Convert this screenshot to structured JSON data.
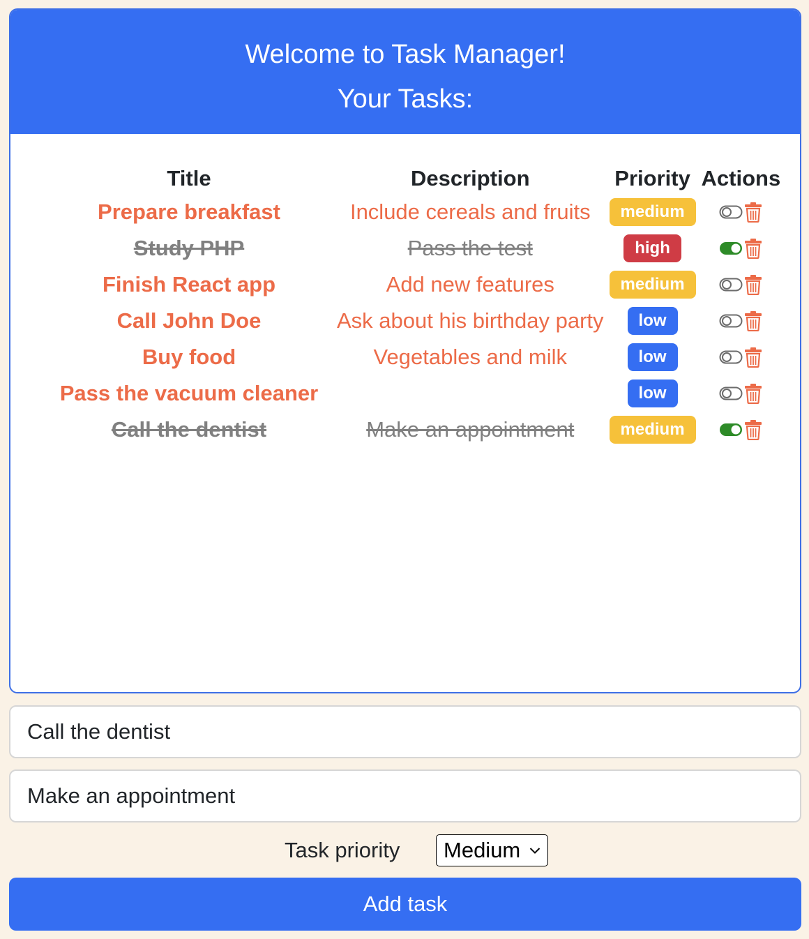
{
  "header": {
    "welcome": "Welcome to Task Manager!",
    "subtitle": "Your Tasks:"
  },
  "table": {
    "columns": [
      "Title",
      "Description",
      "Priority",
      "Actions"
    ]
  },
  "tasks": [
    {
      "title": "Prepare breakfast",
      "description": "Include cereals and fruits",
      "priority": "medium",
      "done": false
    },
    {
      "title": "Study PHP",
      "description": "Pass the test",
      "priority": "high",
      "done": true
    },
    {
      "title": "Finish React app",
      "description": "Add new features",
      "priority": "medium",
      "done": false
    },
    {
      "title": "Call John Doe",
      "description": "Ask about his birthday party",
      "priority": "low",
      "done": false
    },
    {
      "title": "Buy food",
      "description": "Vegetables and milk",
      "priority": "low",
      "done": false
    },
    {
      "title": "Pass the vacuum cleaner",
      "description": "",
      "priority": "low",
      "done": false
    },
    {
      "title": "Call the dentist",
      "description": "Make an appointment",
      "priority": "medium",
      "done": true
    }
  ],
  "priority_colors": {
    "medium": "#f6c13a",
    "high": "#cf3c45",
    "low": "#356ef2"
  },
  "form": {
    "title_value": "Call the dentist",
    "description_value": "Make an appointment",
    "priority_label": "Task priority",
    "priority_selected": "Medium",
    "add_button_label": "Add task"
  },
  "icons": {
    "toggle_off": "toggle-off-icon",
    "toggle_on": "toggle-on-icon",
    "delete": "trash-icon"
  },
  "colors": {
    "accent": "#356ef2",
    "task_text": "#ec6b48",
    "done_text": "#808080",
    "toggle_on": "#2e8b28",
    "page_bg": "#faf2e6"
  }
}
